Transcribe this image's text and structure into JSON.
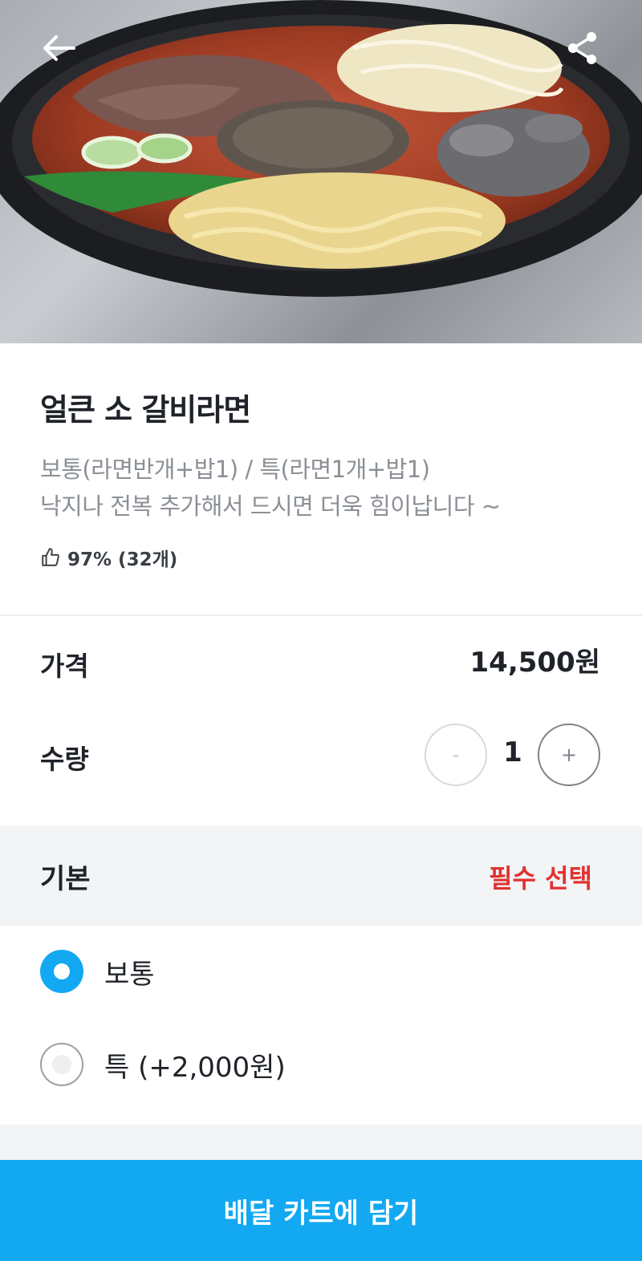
{
  "menu": {
    "title": "얼큰 소 갈비라면",
    "description_line1": "보통(라면반개+밥1) / 특(라면1개+밥1)",
    "description_line2": "낙지나 전복 추가해서 드시면 더욱 힘이납니다 ~",
    "rating": "97% (32개)"
  },
  "price": {
    "label": "가격",
    "value": "14,500원"
  },
  "quantity": {
    "label": "수량",
    "minus": "-",
    "value": "1",
    "plus": "+"
  },
  "options": {
    "group_title": "기본",
    "required_label": "필수 선택",
    "items": [
      {
        "label": "보통",
        "selected": true
      },
      {
        "label": "특 (+2,000원)",
        "selected": false
      }
    ]
  },
  "cart_button": {
    "label": "배달 카트에 담기"
  },
  "icons": {
    "back": "arrow-left-icon",
    "share": "share-icon",
    "rating": "thumbs-up-icon"
  },
  "colors": {
    "accent": "#12a8f2",
    "required": "#e0322f"
  }
}
